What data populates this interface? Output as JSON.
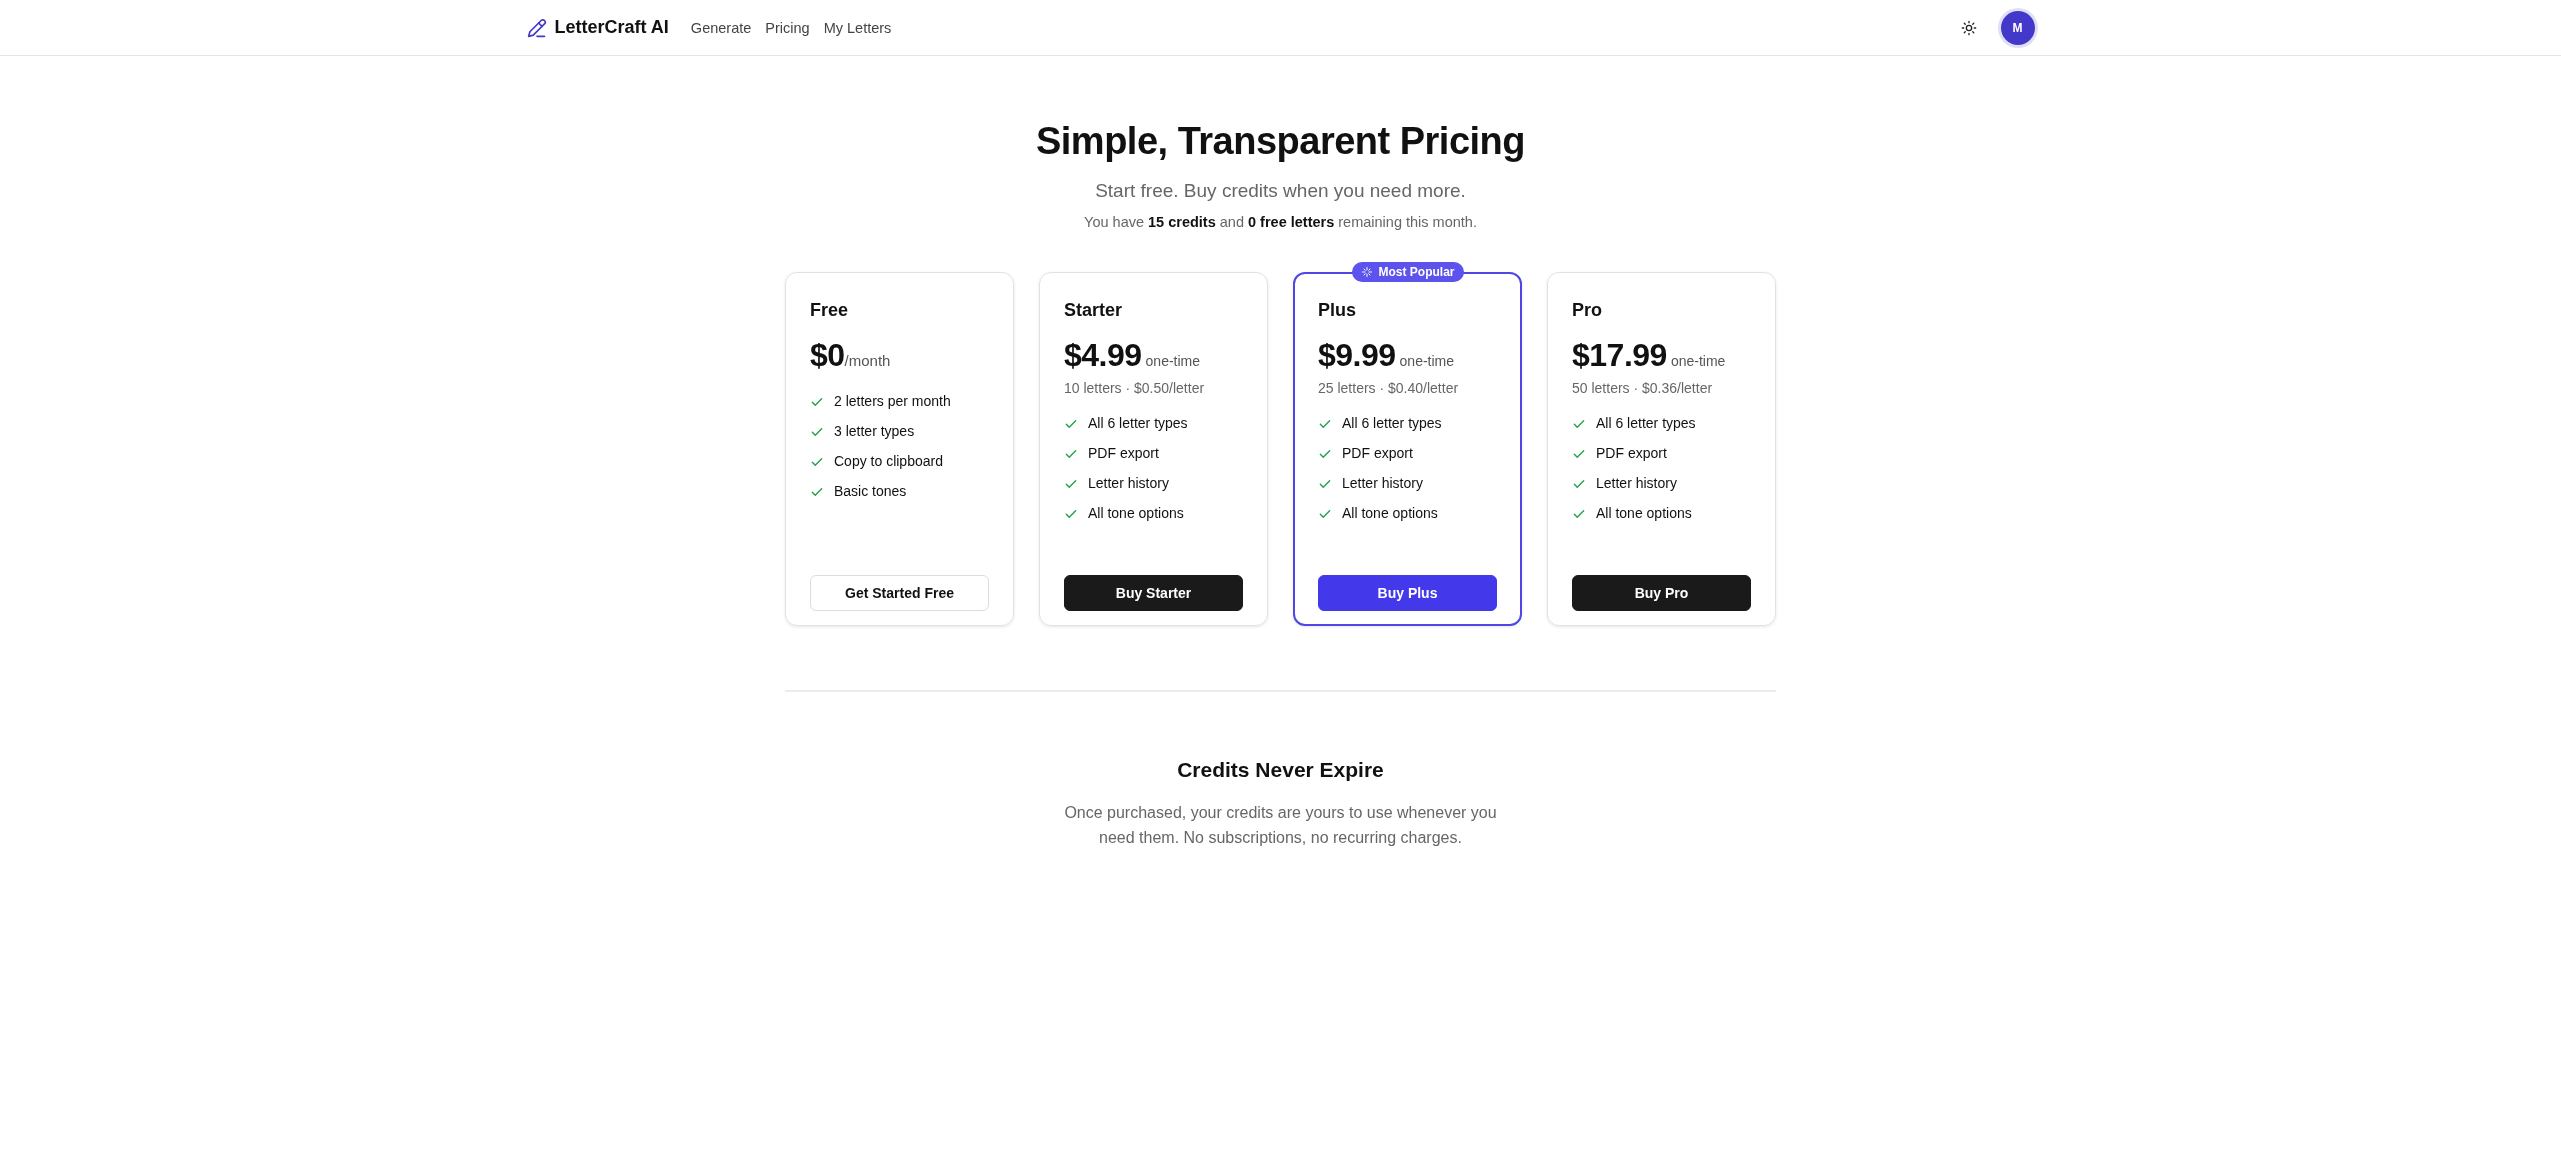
{
  "header": {
    "logo": "LetterCraft AI",
    "nav": [
      {
        "label": "Generate",
        "selected": false
      },
      {
        "label": "Pricing",
        "selected": false
      },
      {
        "label": "My Letters",
        "selected": false
      }
    ],
    "avatar": "M"
  },
  "hero": {
    "title": "Simple, Transparent Pricing",
    "subtitle": "Start free. Buy credits when you need more.",
    "balance": "You have **15 credits** and **0 free letters** remaining this month."
  },
  "plans": [
    {
      "name": "Free",
      "price": "$0",
      "period": "/month",
      "featured": false,
      "features": [
        "2 letters per month",
        "3 letter types",
        "Copy to clipboard",
        "Basic tones"
      ],
      "button": {
        "label": "Get Started Free",
        "kind": "outline"
      }
    },
    {
      "name": "Starter",
      "price": "$4.99",
      "period": "one-time",
      "detail": "10 letters · $0.50/letter",
      "featured": false,
      "features": [
        "All 6 letter types",
        "PDF export",
        "Letter history",
        "All tone options"
      ],
      "button": {
        "label": "Buy Starter",
        "kind": "dark"
      }
    },
    {
      "name": "Plus",
      "price": "$9.99",
      "period": "one-time",
      "detail": "25 letters · $0.40/letter",
      "featured": true,
      "badge": "Most Popular",
      "features": [
        "All 6 letter types",
        "PDF export",
        "Letter history",
        "All tone options"
      ],
      "button": {
        "label": "Buy Plus",
        "kind": "primary"
      }
    },
    {
      "name": "Pro",
      "price": "$17.99",
      "period": "one-time",
      "detail": "50 letters · $0.36/letter",
      "featured": false,
      "features": [
        "All 6 letter types",
        "PDF export",
        "Letter history",
        "All tone options"
      ],
      "button": {
        "label": "Buy Pro",
        "kind": "dark"
      }
    }
  ],
  "note": {
    "title": "Credits Never Expire",
    "text": "Once purchased, your credits are yours to use whenever you need them. No subscriptions, no recurring charges."
  }
}
